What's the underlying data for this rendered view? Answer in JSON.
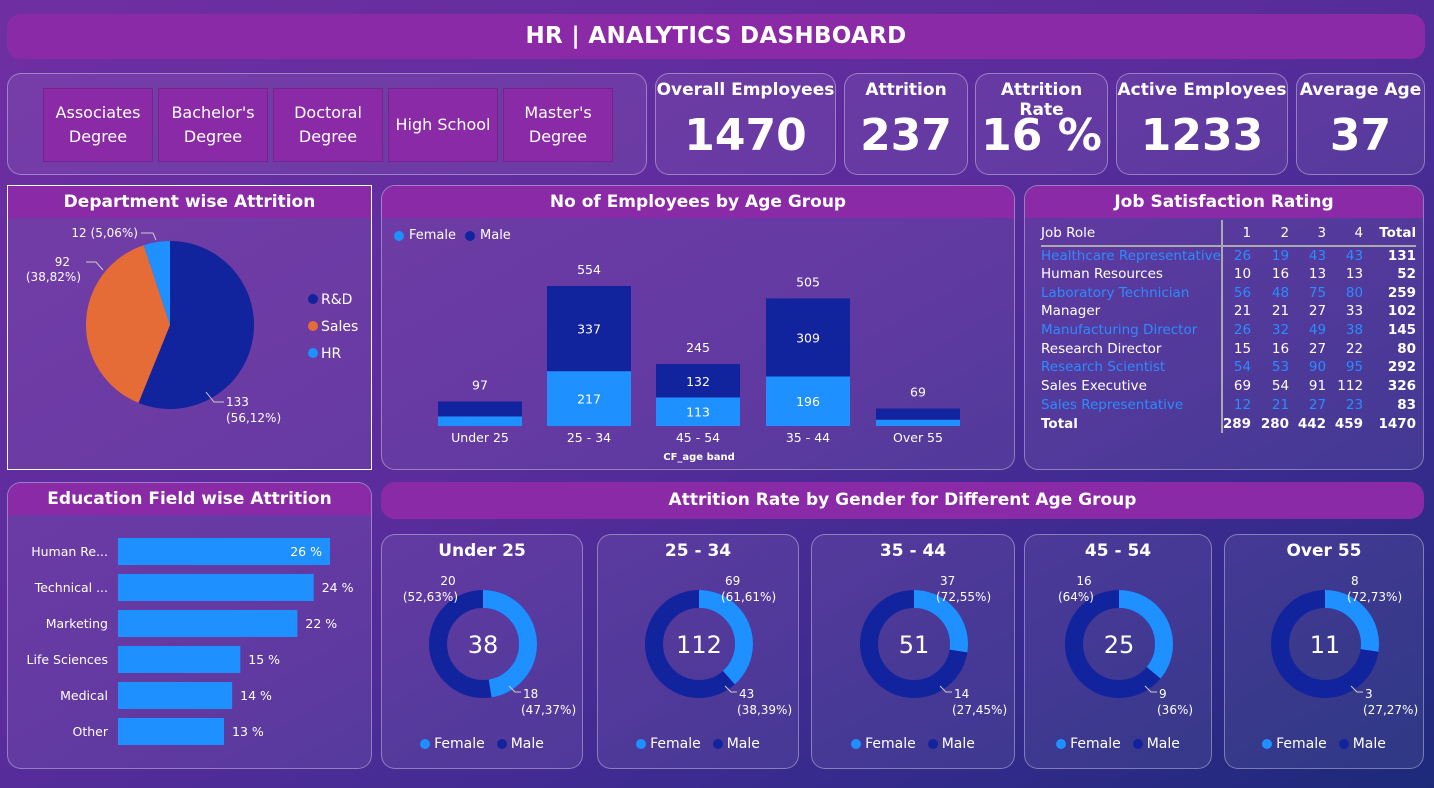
{
  "title": "HR | ANALYTICS DASHBOARD",
  "colors": {
    "female": "#1e90ff",
    "male": "#12239e",
    "sales": "#e66c37",
    "hr": "#1e90ff",
    "rd": "#12239e",
    "panel_header": "#8a2aa6"
  },
  "slicer": {
    "items": [
      "Associates Degree",
      "Bachelor's Degree",
      "Doctoral Degree",
      "High School",
      "Master's Degree"
    ]
  },
  "kpis": [
    {
      "label": "Overall Employees",
      "value": "1470"
    },
    {
      "label": "Attrition",
      "value": "237"
    },
    {
      "label": "Attrition Rate",
      "value": "16 %"
    },
    {
      "label": "Active Employees",
      "value": "1233"
    },
    {
      "label": "Average Age",
      "value": "37"
    }
  ],
  "dept_attrition": {
    "title": "Department wise Attrition",
    "legend": [
      "R&D",
      "Sales",
      "HR"
    ],
    "labels": {
      "rd_value": "133",
      "rd_pct": "(56,12%)",
      "sales_value": "92",
      "sales_pct": "(38,82%)",
      "hr": "12 (5,06%)"
    }
  },
  "age_group": {
    "title": "No of Employees by Age Group",
    "legend": [
      "Female",
      "Male"
    ],
    "xlabel": "CF_age band"
  },
  "job_satisfaction": {
    "title": "Job Satisfaction Rating",
    "headers": [
      "Job Role",
      "1",
      "2",
      "3",
      "4",
      "Total"
    ],
    "rows": [
      [
        "Healthcare Representative",
        "26",
        "19",
        "43",
        "43",
        "131"
      ],
      [
        "Human Resources",
        "10",
        "16",
        "13",
        "13",
        "52"
      ],
      [
        "Laboratory Technician",
        "56",
        "48",
        "75",
        "80",
        "259"
      ],
      [
        "Manager",
        "21",
        "21",
        "27",
        "33",
        "102"
      ],
      [
        "Manufacturing Director",
        "26",
        "32",
        "49",
        "38",
        "145"
      ],
      [
        "Research Director",
        "15",
        "16",
        "27",
        "22",
        "80"
      ],
      [
        "Research Scientist",
        "54",
        "53",
        "90",
        "95",
        "292"
      ],
      [
        "Sales Executive",
        "69",
        "54",
        "91",
        "112",
        "326"
      ],
      [
        "Sales Representative",
        "12",
        "21",
        "27",
        "23",
        "83"
      ]
    ],
    "total_row": [
      "Total",
      "289",
      "280",
      "442",
      "459",
      "1470"
    ]
  },
  "education": {
    "title": "Education Field wise Attrition"
  },
  "gender_age": {
    "title": "Attrition Rate by Gender for Different Age Group",
    "legend": [
      "Female",
      "Male"
    ],
    "donuts": [
      {
        "title": "Under 25",
        "center": "38",
        "male_label": "20",
        "male_pct": "(52,63%)",
        "female_label": "18",
        "female_pct": "(47,37%)",
        "female_share": 0.4737
      },
      {
        "title": "25 - 34",
        "center": "112",
        "male_label": "69",
        "male_pct": "(61,61%)",
        "female_label": "43",
        "female_pct": "(38,39%)",
        "female_share": 0.3839
      },
      {
        "title": "35 - 44",
        "center": "51",
        "male_label": "37",
        "male_pct": "(72,55%)",
        "female_label": "14",
        "female_pct": "(27,45%)",
        "female_share": 0.2745
      },
      {
        "title": "45 - 54",
        "center": "25",
        "male_label": "16",
        "male_pct": "(64%)",
        "female_label": "9",
        "female_pct": "(36%)",
        "female_share": 0.36
      },
      {
        "title": "Over 55",
        "center": "11",
        "male_label": "8",
        "male_pct": "(72,73%)",
        "female_label": "3",
        "female_pct": "(27,27%)",
        "female_share": 0.2727
      }
    ]
  },
  "chart_data": [
    {
      "type": "pie",
      "title": "Department wise Attrition",
      "categories": [
        "R&D",
        "Sales",
        "HR"
      ],
      "values": [
        133,
        92,
        12
      ]
    },
    {
      "type": "bar",
      "stacked": true,
      "title": "No of Employees by Age Group",
      "xlabel": "CF_age band",
      "categories": [
        "Under 25",
        "25 - 34",
        "45 - 54",
        "35 - 44",
        "Over 55"
      ],
      "totals": [
        97,
        554,
        245,
        505,
        69
      ],
      "series": [
        {
          "name": "Female",
          "values": [
            38,
            217,
            113,
            196,
            25
          ],
          "labels": [
            "",
            "217",
            "113",
            "196",
            ""
          ]
        },
        {
          "name": "Male",
          "values": [
            59,
            337,
            132,
            309,
            44
          ],
          "labels": [
            "",
            "337",
            "132",
            "309",
            ""
          ]
        }
      ],
      "legend": "top-left"
    },
    {
      "type": "bar",
      "orientation": "horizontal",
      "title": "Education Field wise Attrition",
      "categories": [
        "Human Re...",
        "Technical ...",
        "Marketing",
        "Life Sciences",
        "Medical",
        "Other"
      ],
      "values": [
        26,
        24,
        22,
        15,
        14,
        13
      ],
      "value_labels": [
        "26 %",
        "24 %",
        "22 %",
        "15 %",
        "14 %",
        "13 %"
      ]
    }
  ]
}
